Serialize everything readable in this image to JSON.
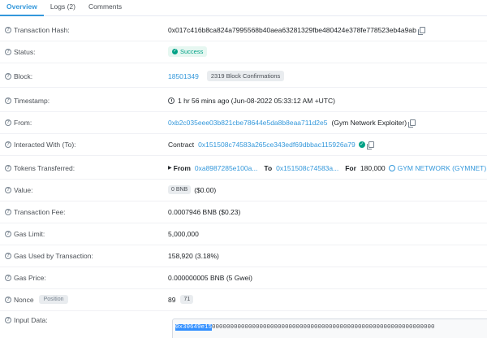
{
  "tabs": [
    {
      "label": "Overview"
    },
    {
      "label": "Logs (2)"
    },
    {
      "label": "Comments"
    }
  ],
  "rows": {
    "hash": {
      "label": "Transaction Hash:",
      "value": "0x017c416b8ca824a7995568b40aea63281329fbe480424e378fe778523eb4a9ab"
    },
    "status": {
      "label": "Status:",
      "value": "Success"
    },
    "block": {
      "label": "Block:",
      "value": "18501349",
      "confirmations": "2319 Block Confirmations"
    },
    "timestamp": {
      "label": "Timestamp:",
      "value": "1 hr 56 mins ago (Jun-08-2022 05:33:12 AM +UTC)"
    },
    "from": {
      "label": "From:",
      "address": "0xb2c035eee03b821cbe78644e5da8b8eaa711d2e5",
      "tag": "(Gym Network Exploiter)"
    },
    "to": {
      "label": "Interacted With (To):",
      "prefix": "Contract",
      "address": "0x151508c74583a265ce343edf69dbbac115926a79"
    },
    "tokens": {
      "label": "Tokens Transferred:",
      "from_label": "From",
      "from_addr": "0xa8987285e100a...",
      "to_label": "To",
      "to_addr": "0x151508c74583a...",
      "for_label": "For",
      "amount": "180,000",
      "token": "GYM NETWORK (GYMNET)"
    },
    "value": {
      "label": "Value:",
      "chip": "0 BNB",
      "usd": "($0.00)"
    },
    "fee": {
      "label": "Transaction Fee:",
      "value": "0.0007946 BNB ($0.23)"
    },
    "gas_limit": {
      "label": "Gas Limit:",
      "value": "5,000,000"
    },
    "gas_used": {
      "label": "Gas Used by Transaction:",
      "value": "158,920 (3.18%)"
    },
    "gas_price": {
      "label": "Gas Price:",
      "value": "0.000000005 BNB (5 Gwei)"
    },
    "nonce": {
      "label": "Nonce",
      "position_chip": "Position",
      "value": "89",
      "position": "71"
    },
    "input": {
      "label": "Input Data:",
      "selected": "0x30649e15",
      "rest": "0000000000000000000000000000000000000000000000000000000000000"
    }
  },
  "icons": {
    "help": "question-circle-icon",
    "copy": "copy-icon",
    "clock": "clock-icon",
    "check": "check-circle-icon"
  },
  "colors": {
    "link": "#3498db",
    "success": "#00a186",
    "active_tab": "#3498db"
  }
}
